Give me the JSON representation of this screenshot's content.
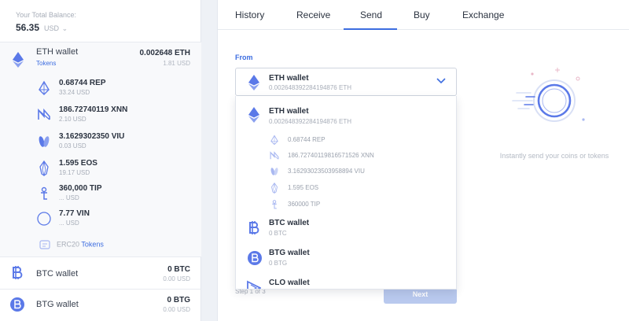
{
  "colors": {
    "accent": "#3d6de0",
    "icon": "#5b79e8",
    "icon_light": "#a9b8f1",
    "muted": "#a7adb8"
  },
  "balance": {
    "label": "Your Total Balance:",
    "value": "56.35",
    "currency": "USD"
  },
  "eth_wallet": {
    "name": "ETH wallet",
    "tokens_link": "Tokens",
    "amount": "0.002648 ETH",
    "usd": "1.81 USD",
    "tokens": [
      {
        "icon": "rep-icon",
        "amount": "0.68744 REP",
        "usd": "33.24 USD"
      },
      {
        "icon": "xnn-icon",
        "amount": "186.72740119 XNN",
        "usd": "2.10 USD"
      },
      {
        "icon": "viu-icon",
        "amount": "3.1629302350 VIU",
        "usd": "0.03 USD"
      },
      {
        "icon": "eos-icon",
        "amount": "1.595 EOS",
        "usd": "19.17 USD"
      },
      {
        "icon": "tip-icon",
        "amount": "360,000 TIP",
        "usd": "... USD"
      },
      {
        "icon": "vin-icon",
        "amount": "7.77 VIN",
        "usd": "... USD"
      }
    ],
    "erc20_prefix": "ERC20",
    "erc20_link": "Tokens"
  },
  "other_wallets": [
    {
      "icon": "btc-icon",
      "name": "BTC wallet",
      "amount": "0 BTC",
      "usd": "0.00 USD"
    },
    {
      "icon": "btg-icon",
      "name": "BTG wallet",
      "amount": "0 BTG",
      "usd": "0.00 USD"
    }
  ],
  "tabs": [
    "History",
    "Receive",
    "Send",
    "Buy",
    "Exchange"
  ],
  "active_tab": "Send",
  "send": {
    "from_label": "From",
    "selected": {
      "name": "ETH wallet",
      "balance": "0.002648392284194876 ETH"
    },
    "dropdown": {
      "eth": {
        "name": "ETH wallet",
        "balance": "0.002648392284194876 ETH"
      },
      "eth_tokens": [
        {
          "icon": "rep-icon",
          "amount": "0.68744 REP"
        },
        {
          "icon": "xnn-icon",
          "amount": "186.72740119816571526 XNN"
        },
        {
          "icon": "viu-icon",
          "amount": "3.16293023503958894 VIU"
        },
        {
          "icon": "eos-icon",
          "amount": "1.595 EOS"
        },
        {
          "icon": "tip-icon",
          "amount": "360000 TIP"
        }
      ],
      "btc": {
        "name": "BTC wallet",
        "balance": "0 BTC"
      },
      "btg": {
        "name": "BTG wallet",
        "balance": "0 BTG"
      },
      "clo": {
        "name": "CLO wallet"
      }
    },
    "step": "Step 1 of 3",
    "next": "Next",
    "hint": "Instantly send your coins or tokens"
  }
}
